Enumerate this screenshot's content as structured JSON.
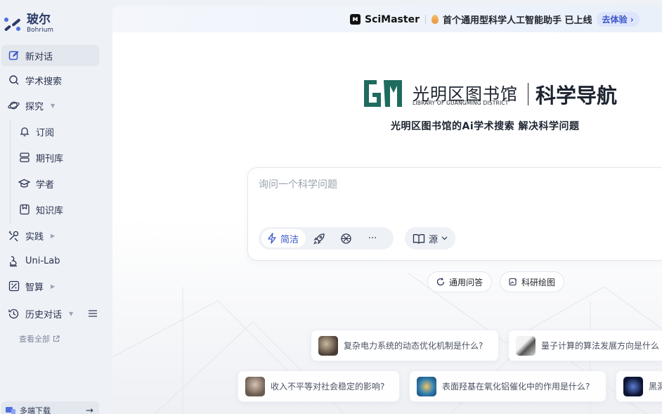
{
  "sidebar": {
    "logo_cn": "玻尔",
    "logo_en": "Bohrium",
    "items": [
      {
        "label": "新对话"
      },
      {
        "label": "学术搜索"
      },
      {
        "label": "探究"
      },
      {
        "label": "订阅"
      },
      {
        "label": "期刊库"
      },
      {
        "label": "学者"
      },
      {
        "label": "知识库"
      },
      {
        "label": "实践"
      },
      {
        "label": "Uni-Lab"
      },
      {
        "label": "智算"
      },
      {
        "label": "历史对话"
      }
    ],
    "view_all": "查看全部",
    "download": "多端下载"
  },
  "banner": {
    "brand": "SciMaster",
    "text": "首个通用型科学人工智能助手 已上线",
    "cta": "去体验 ›"
  },
  "header": {
    "library_cn": "光明区图书馆",
    "library_en": "LIBRARY OF GUANGMING DISTRICT",
    "nav_title": "科学导航",
    "subtitle": "光明区图书馆的Ai学术搜索  解决科学问题"
  },
  "query": {
    "placeholder": "询问一个科学问题",
    "mode_active": "简洁",
    "more": "···",
    "source": "源"
  },
  "pills": [
    {
      "label": "通用问答"
    },
    {
      "label": "科研绘图"
    }
  ],
  "suggestions": [
    {
      "text": "复杂电力系统的动态优化机制是什么?"
    },
    {
      "text": "量子计算的算法发展方向是什么"
    },
    {
      "text": "收入不平等对社会稳定的影响?"
    },
    {
      "text": "表面羟基在氧化铝催化中的作用是什么?"
    },
    {
      "text": "黑洞"
    }
  ],
  "colors": {
    "accent": "#3a55c8",
    "sidebar_bg": "#eef1f6",
    "logo_green": "#1f6b5e"
  }
}
